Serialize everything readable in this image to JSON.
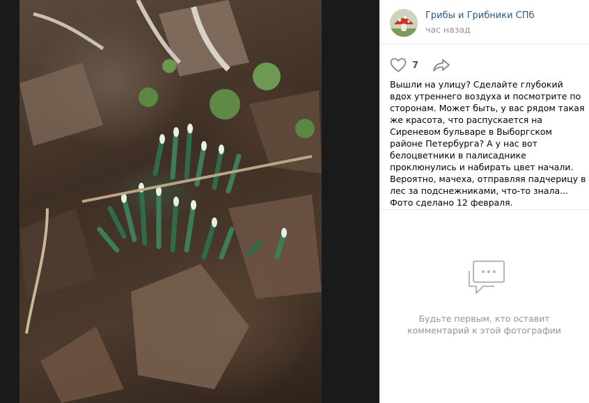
{
  "photo": {
    "name": "photo"
  },
  "post": {
    "author": "Грибы и Грибники СПб",
    "time": "час назад",
    "likes": "7",
    "description": "Вышли на улицу? Сделайте глубокий вдох утреннего воздуха и посмотрите по сторонам. Может быть, у вас рядом такая же красота, что распускается на Сиреневом бульваре в Выборгском районе Петербурга? А у нас вот белоцветники в палисаднике проклюнулись и набирать цвет начали. Вероятно, мачеха, отправляя падчерицу в лес за подснежниками, что-то знала... Фото сделано 12 февраля."
  },
  "comments": {
    "empty_line1": "Будьте первым, кто оставит",
    "empty_line2": "комментарий к этой фотографии"
  },
  "colors": {
    "link": "#2a5885",
    "muted": "#939393",
    "icon": "#828a99",
    "divider": "#e7e8ec",
    "dark_pane": "#1a1a1a"
  },
  "icons": {
    "like": "heart-icon",
    "share": "share-arrow-icon",
    "comments": "comment-bubble-icon"
  }
}
